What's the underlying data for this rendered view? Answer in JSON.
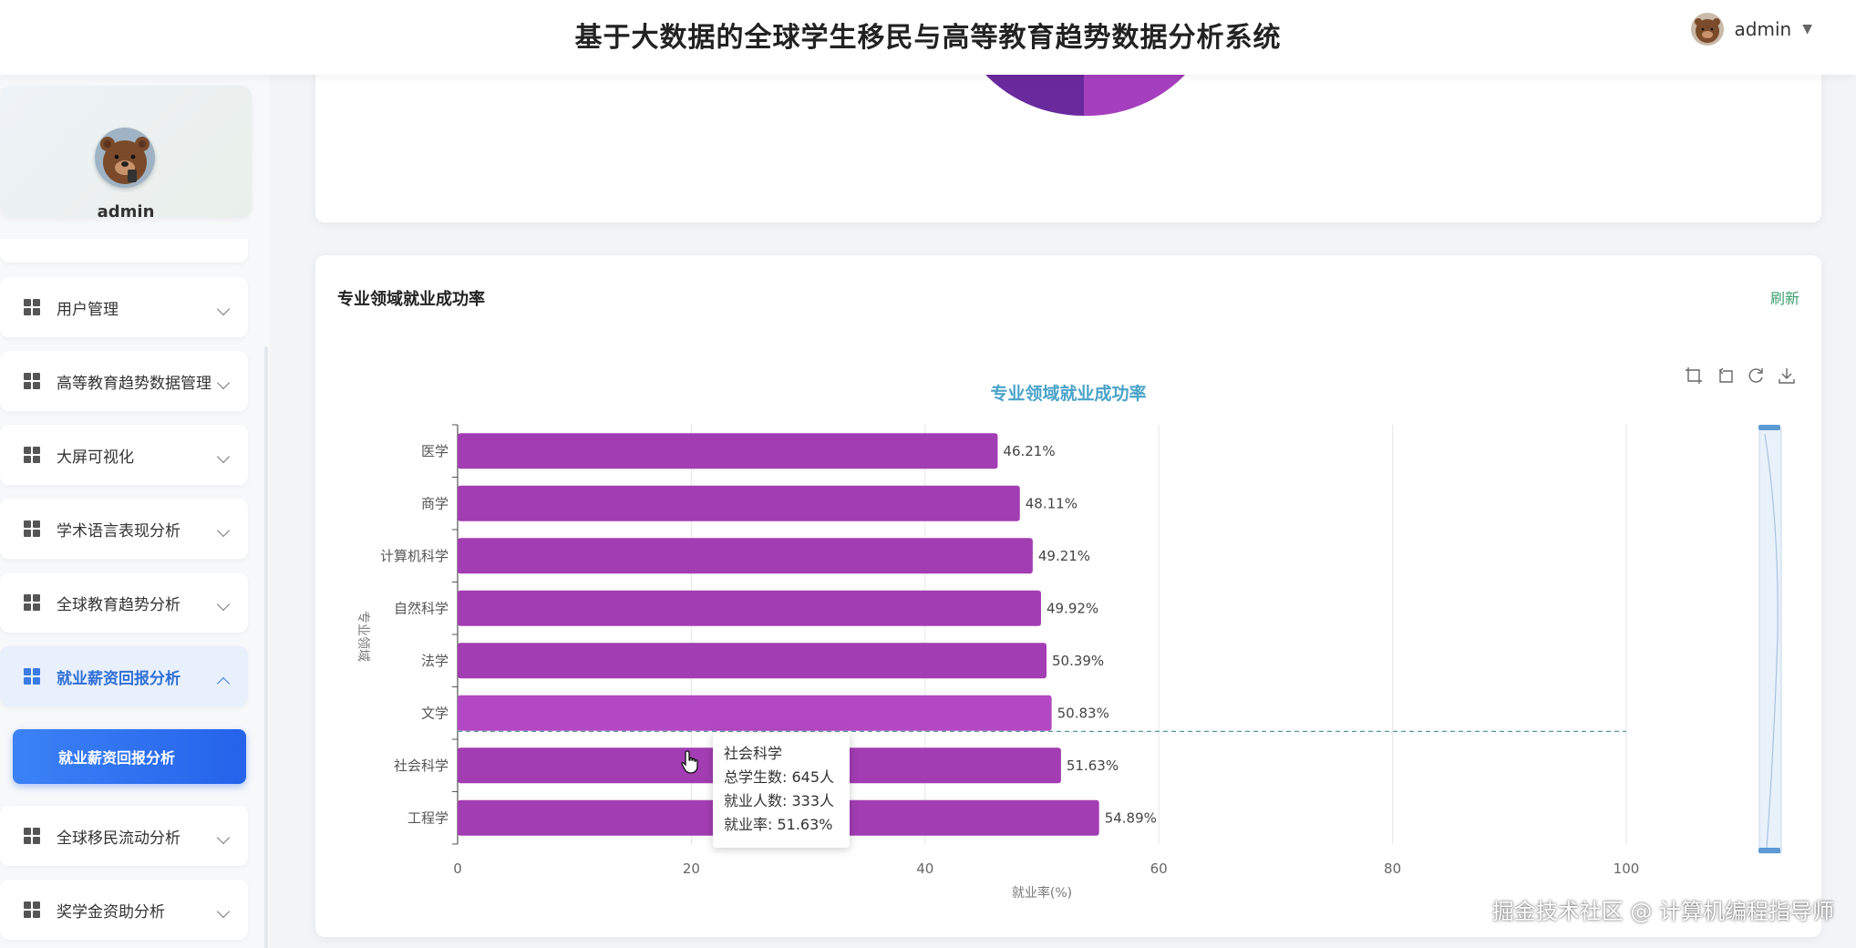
{
  "header": {
    "title": "基于大数据的全球学生移民与高等教育趋势数据分析系统",
    "user": "admin"
  },
  "sidebar": {
    "profile_name": "admin",
    "items": [
      {
        "label": "用户管理"
      },
      {
        "label": "高等教育趋势数据管理"
      },
      {
        "label": "大屏可视化"
      },
      {
        "label": "学术语言表现分析"
      },
      {
        "label": "全球教育趋势分析"
      },
      {
        "label": "就业薪资回报分析"
      },
      {
        "label": "全球移民流动分析"
      },
      {
        "label": "奖学金资助分析"
      }
    ],
    "active_sub": "就业薪资回报分析"
  },
  "card": {
    "title": "专业领域就业成功率",
    "refresh": "刷新"
  },
  "chart_data": {
    "type": "bar",
    "orientation": "horizontal",
    "title": "专业领域就业成功率",
    "xlabel": "就业率(%)",
    "ylabel": "专业领域",
    "xlim": [
      0,
      100
    ],
    "xticks": [
      0,
      20,
      40,
      60,
      80,
      100
    ],
    "categories": [
      "医学",
      "商学",
      "计算机科学",
      "自然科学",
      "法学",
      "文学",
      "社会科学",
      "工程学"
    ],
    "values": [
      46.21,
      48.11,
      49.21,
      49.92,
      50.39,
      50.83,
      51.63,
      54.89
    ],
    "value_labels": [
      "46.21%",
      "48.11%",
      "49.21%",
      "49.92%",
      "50.39%",
      "50.83%",
      "51.63%",
      "54.89%"
    ],
    "bar_color": "#a33db3",
    "highlight_color": "#b348c4",
    "highlight_index": 5,
    "grid": true
  },
  "tooltip": {
    "lines": [
      "社会科学",
      "总学生数: 645人",
      "就业人数: 333人",
      "就业率: 51.63%"
    ]
  },
  "watermark": "掘金技术社区 @ 计算机编程指导师",
  "icons": [
    "zoom-area-icon",
    "zoom-reset-icon",
    "restore-icon",
    "download-icon",
    "grid-icon",
    "chevron-down-icon"
  ]
}
